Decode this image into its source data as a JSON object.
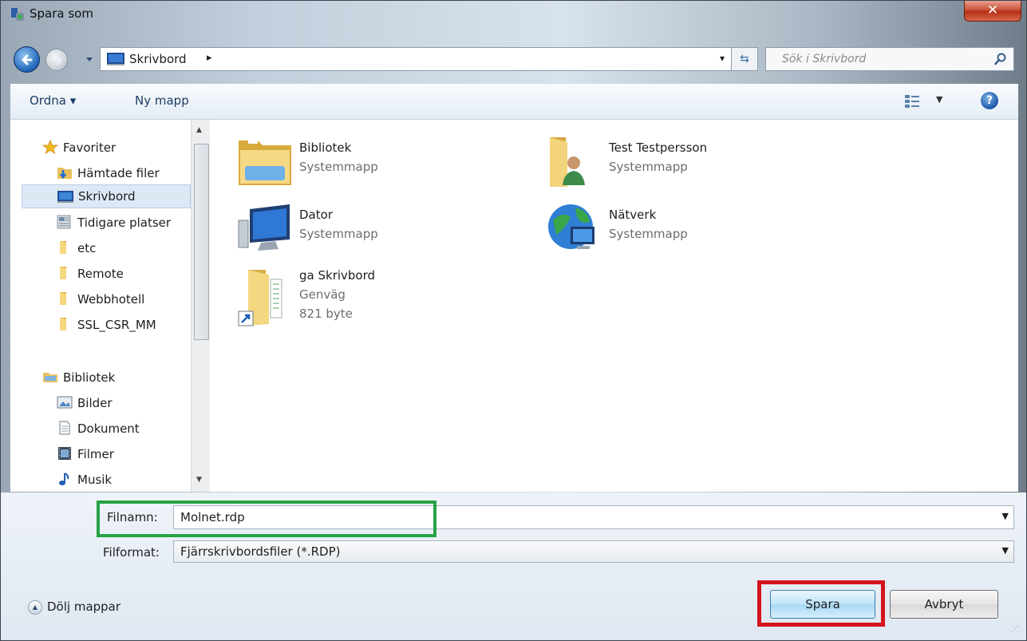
{
  "window": {
    "title": "Spara som",
    "close_label": "✕"
  },
  "address": {
    "location": "Skrivbord",
    "chevron": "▸",
    "dropdown": "▾"
  },
  "search": {
    "placeholder": "Sök i Skrivbord"
  },
  "toolbar": {
    "organize": "Ordna ▾",
    "new_folder": "Ny mapp",
    "help": "?"
  },
  "nav_pane": {
    "favorites": [
      {
        "label": "Favoriter",
        "icon": "star-icon"
      },
      {
        "label": "Hämtade filer",
        "icon": "download-folder-icon"
      },
      {
        "label": "Skrivbord",
        "icon": "desktop-icon"
      },
      {
        "label": "Tidigare platser",
        "icon": "recent-places-icon"
      },
      {
        "label": "etc",
        "icon": "folder-icon"
      },
      {
        "label": "Remote",
        "icon": "folder-icon"
      },
      {
        "label": "Webbhotell",
        "icon": "folder-icon"
      },
      {
        "label": "SSL_CSR_MM",
        "icon": "folder-icon"
      }
    ],
    "libraries": [
      {
        "label": "Bibliotek",
        "icon": "library-icon"
      },
      {
        "label": "Bilder",
        "icon": "pictures-icon"
      },
      {
        "label": "Dokument",
        "icon": "document-icon"
      },
      {
        "label": "Filmer",
        "icon": "video-icon"
      },
      {
        "label": "Musik",
        "icon": "music-icon"
      }
    ]
  },
  "items": [
    {
      "name": "Bibliotek",
      "type": "Systemmapp",
      "icon": "library-folder-icon"
    },
    {
      "name": "Test Testpersson",
      "type": "Systemmapp",
      "icon": "user-folder-icon"
    },
    {
      "name": "Dator",
      "type": "Systemmapp",
      "icon": "computer-icon"
    },
    {
      "name": "Nätverk",
      "type": "Systemmapp",
      "icon": "network-icon"
    },
    {
      "name": "ga Skrivbord",
      "type": "Genväg",
      "size": "821 byte",
      "icon": "shortcut-icon"
    }
  ],
  "form": {
    "filename_label": "Filnamn:",
    "filename_value": "Molnet.rdp",
    "format_label": "Filformat:",
    "format_value": "Fjärrskrivbordsfiler (*.RDP)"
  },
  "footer": {
    "hide_folders": "Dölj mappar",
    "save": "Spara",
    "cancel": "Avbryt"
  },
  "colors": {
    "highlight_green": "#26a346",
    "highlight_red": "#d4141c"
  }
}
